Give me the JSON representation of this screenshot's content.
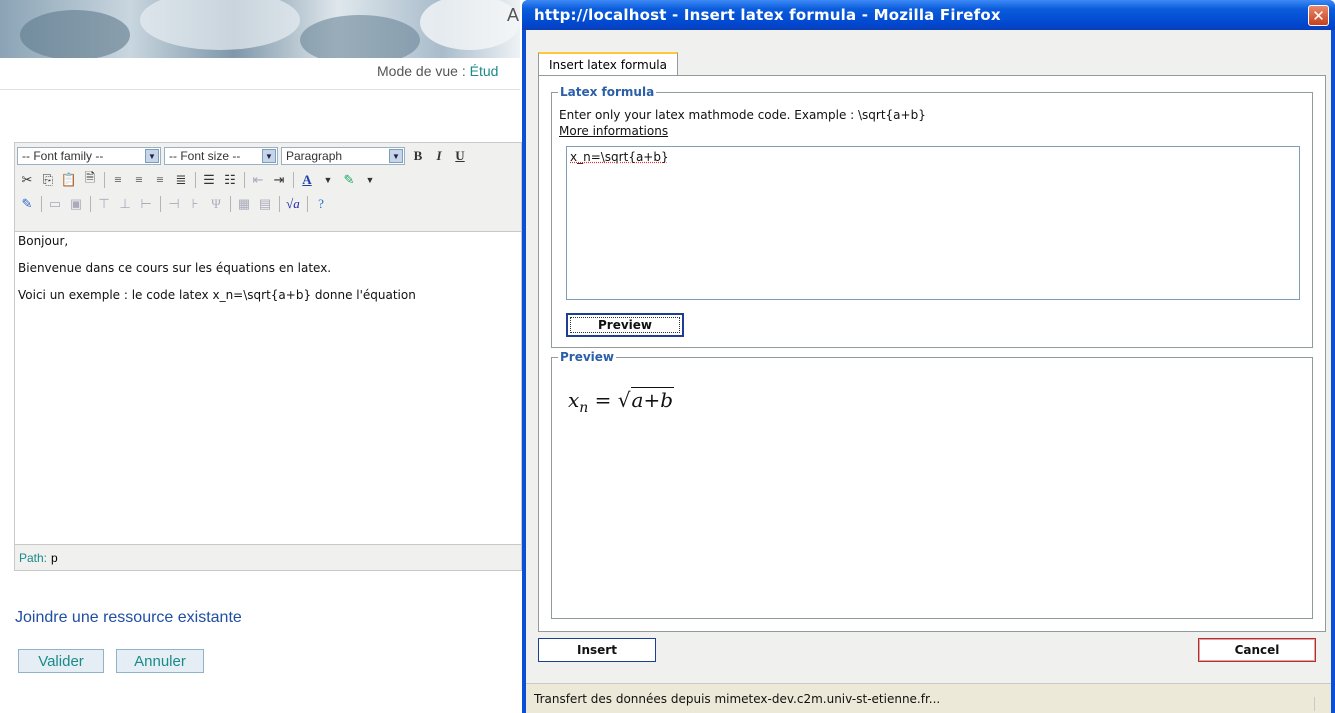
{
  "background": {
    "banner_letter": "A",
    "mode_label": "Mode de vue : ",
    "mode_value": "Étud"
  },
  "editor": {
    "font_family": "-- Font family --",
    "font_size": "-- Font size --",
    "paragraph": "Paragraph",
    "bold": "B",
    "italic": "I",
    "underline": "U",
    "content": [
      "Bonjour,",
      "Bienvenue dans ce cours sur les équations en latex.",
      "Voici un exemple : le code latex x_n=\\sqrt{a+b} donne l'équation"
    ],
    "path_label": "Path:",
    "path_value": "p"
  },
  "page": {
    "joindre": "Joindre une ressource existante",
    "valider": "Valider",
    "annuler": "Annuler"
  },
  "dialog": {
    "title": "http://localhost - Insert latex formula - Mozilla Firefox",
    "close": "✕",
    "tab": "Insert latex formula",
    "latex_legend": "Latex formula",
    "instructions": "Enter only your latex mathmode code. Example : \\sqrt{a+b}",
    "more_info": "More informations",
    "input_value": "x_n=\\sqrt{a+b}",
    "preview_button": "Preview",
    "preview_legend": "Preview",
    "formula_x": "x",
    "formula_sub": "n",
    "formula_eq": " = ",
    "formula_sqrt": "√",
    "formula_rad": "a+b",
    "insert_button": "Insert",
    "cancel_button": "Cancel",
    "status": "Transfert des données depuis mimetex-dev.c2m.univ-st-etienne.fr..."
  }
}
